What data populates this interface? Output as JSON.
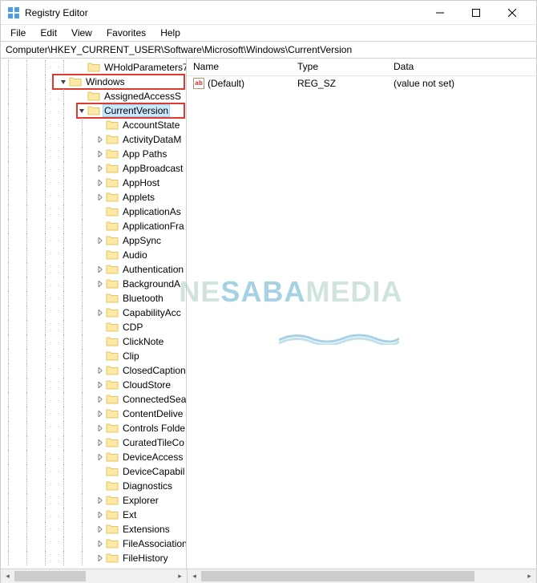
{
  "window": {
    "title": "Registry Editor"
  },
  "menu": {
    "file": "File",
    "edit": "Edit",
    "view": "View",
    "favorites": "Favorites",
    "help": "Help"
  },
  "address": "Computer\\HKEY_CURRENT_USER\\Software\\Microsoft\\Windows\\CurrentVersion",
  "tree": {
    "items": [
      {
        "indent": 4,
        "expander": "",
        "label": "WHoldParameters7"
      },
      {
        "indent": 3,
        "expander": "v",
        "label": "Windows",
        "boxed": true,
        "boxLeft": 64
      },
      {
        "indent": 4,
        "expander": "",
        "label": "AssignedAccessS"
      },
      {
        "indent": 4,
        "expander": "v",
        "label": "CurrentVersion",
        "selected": true,
        "boxed": true,
        "boxLeft": 94
      },
      {
        "indent": 5,
        "expander": "",
        "label": "AccountState"
      },
      {
        "indent": 5,
        "expander": ">",
        "label": "ActivityDataM"
      },
      {
        "indent": 5,
        "expander": ">",
        "label": "App Paths"
      },
      {
        "indent": 5,
        "expander": ">",
        "label": "AppBroadcast"
      },
      {
        "indent": 5,
        "expander": ">",
        "label": "AppHost"
      },
      {
        "indent": 5,
        "expander": ">",
        "label": "Applets"
      },
      {
        "indent": 5,
        "expander": "",
        "label": "ApplicationAs"
      },
      {
        "indent": 5,
        "expander": "",
        "label": "ApplicationFra"
      },
      {
        "indent": 5,
        "expander": ">",
        "label": "AppSync"
      },
      {
        "indent": 5,
        "expander": "",
        "label": "Audio"
      },
      {
        "indent": 5,
        "expander": ">",
        "label": "Authentication"
      },
      {
        "indent": 5,
        "expander": ">",
        "label": "BackgroundA"
      },
      {
        "indent": 5,
        "expander": "",
        "label": "Bluetooth"
      },
      {
        "indent": 5,
        "expander": ">",
        "label": "CapabilityAcc"
      },
      {
        "indent": 5,
        "expander": "",
        "label": "CDP"
      },
      {
        "indent": 5,
        "expander": "",
        "label": "ClickNote"
      },
      {
        "indent": 5,
        "expander": "",
        "label": "Clip"
      },
      {
        "indent": 5,
        "expander": ">",
        "label": "ClosedCaption"
      },
      {
        "indent": 5,
        "expander": ">",
        "label": "CloudStore"
      },
      {
        "indent": 5,
        "expander": ">",
        "label": "ConnectedSea"
      },
      {
        "indent": 5,
        "expander": ">",
        "label": "ContentDelive"
      },
      {
        "indent": 5,
        "expander": ">",
        "label": "Controls Folde"
      },
      {
        "indent": 5,
        "expander": ">",
        "label": "CuratedTileCo"
      },
      {
        "indent": 5,
        "expander": ">",
        "label": "DeviceAccess"
      },
      {
        "indent": 5,
        "expander": "",
        "label": "DeviceCapabil"
      },
      {
        "indent": 5,
        "expander": "",
        "label": "Diagnostics"
      },
      {
        "indent": 5,
        "expander": ">",
        "label": "Explorer"
      },
      {
        "indent": 5,
        "expander": ">",
        "label": "Ext"
      },
      {
        "indent": 5,
        "expander": ">",
        "label": "Extensions"
      },
      {
        "indent": 5,
        "expander": ">",
        "label": "FileAssociation"
      },
      {
        "indent": 5,
        "expander": ">",
        "label": "FileHistory"
      }
    ]
  },
  "list": {
    "columns": {
      "name": "Name",
      "type": "Type",
      "data": "Data"
    },
    "rows": [
      {
        "name": "(Default)",
        "type": "REG_SZ",
        "data": "(value not set)"
      }
    ]
  },
  "watermark": {
    "part1": "NE",
    "part2": "SABA",
    "part3": "MEDIA"
  }
}
